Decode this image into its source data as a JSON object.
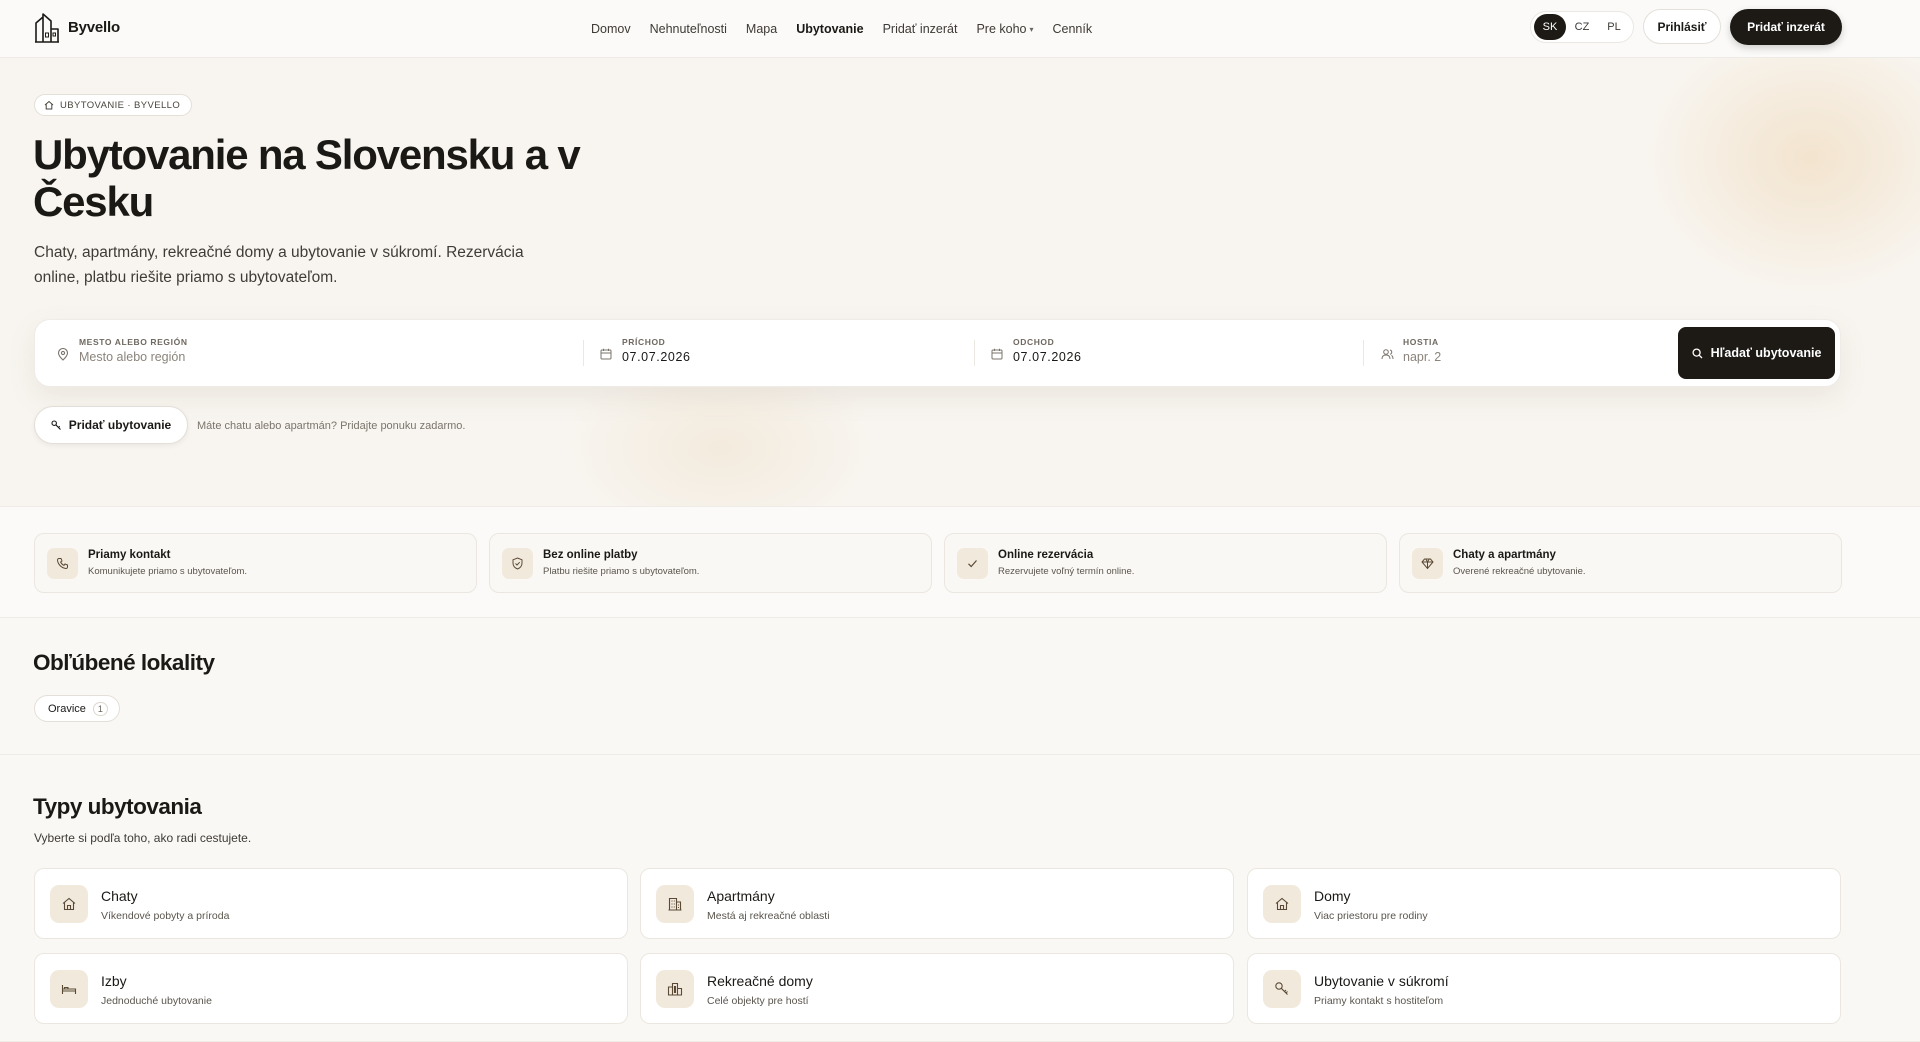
{
  "brand": {
    "name": "Byvello"
  },
  "nav": {
    "items": [
      {
        "label": "Domov"
      },
      {
        "label": "Nehnuteľnosti"
      },
      {
        "label": "Mapa"
      },
      {
        "label": "Ubytovanie",
        "active": true
      },
      {
        "label": "Pridať inzerát"
      },
      {
        "label": "Pre koho",
        "dropdown": true
      },
      {
        "label": "Cenník"
      }
    ],
    "languages": [
      "SK",
      "CZ",
      "PL"
    ],
    "selected_language": "SK",
    "login_label": "Prihlásiť",
    "add_listing_label": "Pridať inzerát"
  },
  "hero": {
    "badge": "UBYTOVANIE · BYVELLO",
    "title": "Ubytovanie na Slovensku a v Česku",
    "subtitle": "Chaty, apartmány, rekreačné domy a ubytovanie v súkromí. Rezervácia online, platbu riešite priamo s ubytovateľom.",
    "search": {
      "location": {
        "label": "MESTO ALEBO REGIÓN",
        "placeholder": "Mesto alebo región"
      },
      "checkin": {
        "label": "PRÍCHOD",
        "value": "07.07.2026"
      },
      "checkout": {
        "label": "ODCHOD",
        "value": "07.07.2026"
      },
      "guests": {
        "label": "HOSTIA",
        "placeholder": "napr. 2"
      },
      "button": "Hľadať ubytovanie"
    },
    "add_stay_button": "Pridať ubytovanie",
    "add_stay_note": "Máte chatu alebo apartmán? Pridajte ponuku zadarmo."
  },
  "features": [
    {
      "title": "Priamy kontakt",
      "desc": "Komunikujete priamo s ubytovateľom.",
      "icon": "phone-icon"
    },
    {
      "title": "Bez online platby",
      "desc": "Platbu riešite priamo s ubytovateľom.",
      "icon": "shield-icon"
    },
    {
      "title": "Online rezervácia",
      "desc": "Rezervujete voľný termín online.",
      "icon": "check-icon"
    },
    {
      "title": "Chaty a apartmány",
      "desc": "Overené rekreačné ubytovanie.",
      "icon": "diamond-icon"
    }
  ],
  "popular": {
    "title": "Obľúbené lokality",
    "items": [
      {
        "label": "Oravice",
        "count": "1"
      }
    ]
  },
  "types": {
    "title": "Typy ubytovania",
    "subtitle": "Vyberte si podľa toho, ako radi cestujete.",
    "items": [
      {
        "title": "Chaty",
        "desc": "Víkendové pobyty a príroda",
        "icon": "house-icon"
      },
      {
        "title": "Apartmány",
        "desc": "Mestá aj rekreačné oblasti",
        "icon": "building-icon"
      },
      {
        "title": "Domy",
        "desc": "Viac priestoru pre rodiny",
        "icon": "house-icon"
      },
      {
        "title": "Izby",
        "desc": "Jednoduché ubytovanie",
        "icon": "bed-icon"
      },
      {
        "title": "Rekreačné domy",
        "desc": "Celé objekty pre hostí",
        "icon": "buildings-icon"
      },
      {
        "title": "Ubytovanie v súkromí",
        "desc": "Priamy kontakt s hostiteľom",
        "icon": "key-icon"
      }
    ]
  },
  "colors": {
    "accent": "#1d1a16",
    "icon_bg": "#f2e9dd",
    "page_bg": "#faf8f5"
  }
}
